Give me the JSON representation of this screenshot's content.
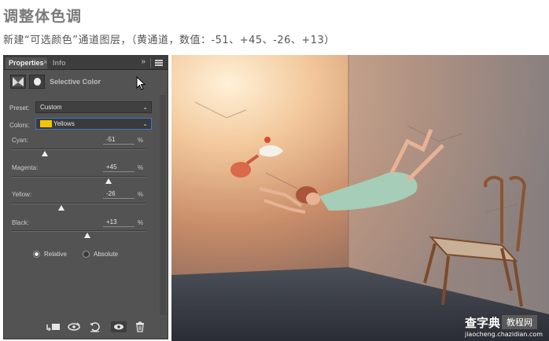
{
  "header": {
    "title": "调整体色调",
    "subtitle": "新建“可选颜色”通道图层，（黄通道，数值：-51、+45、-26、+13）"
  },
  "panel": {
    "tabs": [
      {
        "label": "Properties",
        "active": true
      },
      {
        "label": "Info",
        "active": false
      }
    ],
    "collapse_glyph": "»",
    "adjustment_title": "Selective Color",
    "preset": {
      "label": "Preset:",
      "value": "Custom"
    },
    "colors": {
      "label": "Colors:",
      "value": "Yellows",
      "swatch_color": "#f5c400"
    },
    "sliders": [
      {
        "label": "Cyan:",
        "value": "-51",
        "unit": "%",
        "level": -51
      },
      {
        "label": "Magenta:",
        "value": "+45",
        "unit": "%",
        "level": 45
      },
      {
        "label": "Yellow:",
        "value": "-26",
        "unit": "%",
        "level": -26
      },
      {
        "label": "Black:",
        "value": "+13",
        "unit": "%",
        "level": 13
      }
    ],
    "method": [
      {
        "label": "Relative",
        "selected": true
      },
      {
        "label": "Absolute",
        "selected": false
      }
    ],
    "bottom_icons": [
      "clip-to-layer-icon",
      "view-previous-icon",
      "reset-icon",
      "visibility-icon",
      "delete-icon"
    ]
  },
  "watermark": {
    "main": "查字典",
    "box": "教程网",
    "url": "jiaocheng.chazidian.com"
  },
  "colors": {
    "panel_bg": "#535353",
    "accent": "#3b76c9"
  }
}
